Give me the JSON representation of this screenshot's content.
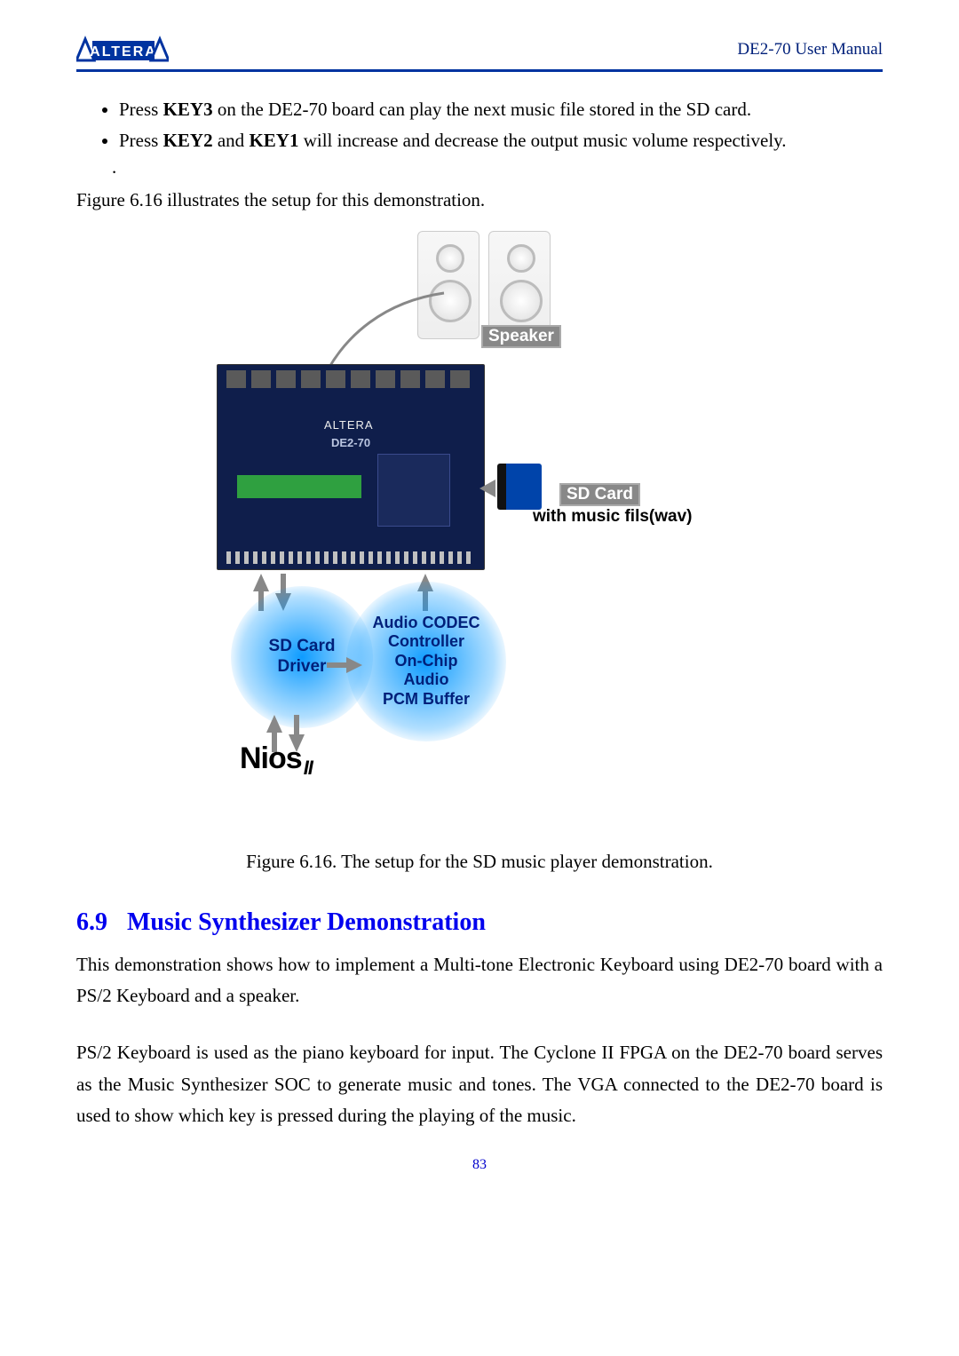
{
  "header": {
    "logo_text": "ALTERA",
    "manual_title": "DE2-70 User Manual"
  },
  "bullets": [
    {
      "pre": "Press ",
      "key": "KEY3",
      "post": " on the DE2-70 board can play the next music file stored in the SD card."
    },
    {
      "pre": "Press ",
      "key": "KEY2",
      "mid": " and ",
      "key2": "KEY1",
      "post": " will increase and decrease the output music volume respectively."
    }
  ],
  "intro": "Figure 6.16 illustrates the setup for this demonstration.",
  "figure": {
    "label_speaker": "Speaker",
    "label_sdcard": "SD Card",
    "label_sd_sub": "with music fils(wav)",
    "board_logo": "ALTERA",
    "board_model": "DE2-70",
    "glow_sd_driver": "SD Card\nDriver",
    "glow_audio_ctrl": "Audio CODEC\nController\nOn-Chip\nAudio\nPCM Buffer",
    "nios": "Nios",
    "nios_suffix": "II"
  },
  "caption": "Figure 6.16.   The setup for the SD music player demonstration.",
  "section": {
    "number": "6.9",
    "title": "Music Synthesizer Demonstration"
  },
  "para1": "This demonstration shows how to implement a Multi-tone Electronic Keyboard using DE2-70 board with a PS/2 Keyboard and a speaker.",
  "para2": "PS/2 Keyboard is used as the piano keyboard for input. The Cyclone II FPGA on the DE2-70 board serves as the Music Synthesizer SOC to generate music and tones. The VGA connected to the DE2-70 board is used to show which key is pressed during the playing of the music.",
  "page_number": "83"
}
